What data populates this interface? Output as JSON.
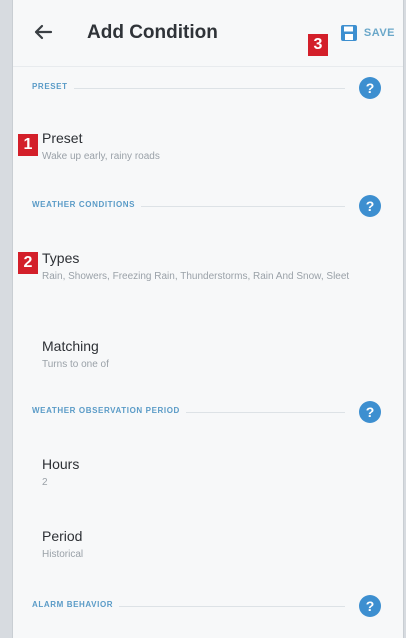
{
  "header": {
    "title": "Add Condition",
    "save_label": "SAVE"
  },
  "badges": [
    "1",
    "2",
    "3"
  ],
  "sections": {
    "preset": {
      "title": "PRESET",
      "item": {
        "label": "Preset",
        "value": "Wake up early, rainy roads"
      }
    },
    "weather": {
      "title": "WEATHER CONDITIONS",
      "types": {
        "label": "Types",
        "value": "Rain, Showers, Freezing Rain, Thunderstorms, Rain And Snow, Sleet"
      },
      "matching": {
        "label": "Matching",
        "value": "Turns to one of"
      }
    },
    "observation": {
      "title": "WEATHER OBSERVATION PERIOD",
      "hours": {
        "label": "Hours",
        "value": "2"
      },
      "period": {
        "label": "Period",
        "value": "Historical"
      }
    },
    "alarm": {
      "title": "ALARM BEHAVIOR"
    }
  },
  "help_glyph": "?",
  "colors": {
    "accent": "#3d8fd0",
    "badge": "#d31f2a",
    "section_title": "#5a9bc7"
  }
}
